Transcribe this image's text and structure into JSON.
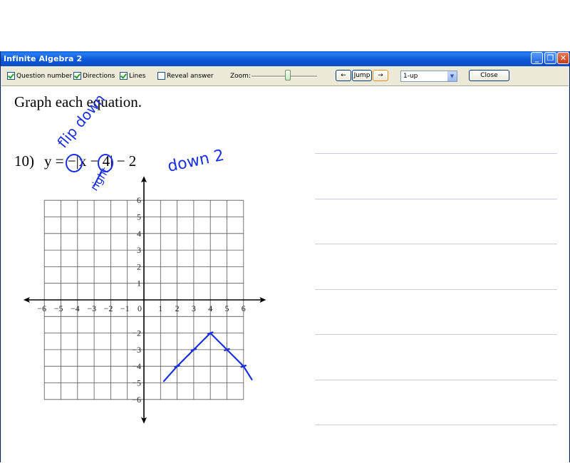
{
  "window": {
    "title": "Infinite Algebra 2",
    "controls": {
      "minimize": "_",
      "restore": "❐",
      "close": "✕"
    }
  },
  "toolbar": {
    "options": [
      {
        "label": "Question number",
        "checked": true
      },
      {
        "label": "Directions",
        "checked": true
      },
      {
        "label": "Lines",
        "checked": true
      },
      {
        "label": "Reveal answer",
        "checked": false
      }
    ],
    "zoom_label": "Zoom:",
    "zoom_level": 0.55,
    "back_label": "←",
    "jump_label": "Jump",
    "forward_label": "→",
    "layout_value": "1-up",
    "close_label": "Close"
  },
  "worksheet": {
    "directions": "Graph each equation.",
    "question_number": "10)",
    "equation": "y = −|x − 4| − 2",
    "axis": {
      "x_ticks": [
        "−6",
        "−5",
        "−4",
        "−3",
        "−2",
        "−1",
        "0",
        "1",
        "2",
        "3",
        "4",
        "5",
        "6"
      ],
      "y_ticks_positive": [
        "6",
        "5",
        "4",
        "3",
        "2",
        "1"
      ],
      "y_ticks_negative": [
        "−2",
        "−3",
        "−4",
        "−5",
        "−6"
      ]
    },
    "student_answer": {
      "ink_color": "#1a2fe0",
      "annotations": [
        "flip down",
        "right",
        "down 2"
      ],
      "plotted_points": [
        [
          2,
          -4
        ],
        [
          3,
          -3
        ],
        [
          4,
          -2
        ],
        [
          5,
          -3
        ],
        [
          6,
          -4
        ]
      ]
    }
  }
}
